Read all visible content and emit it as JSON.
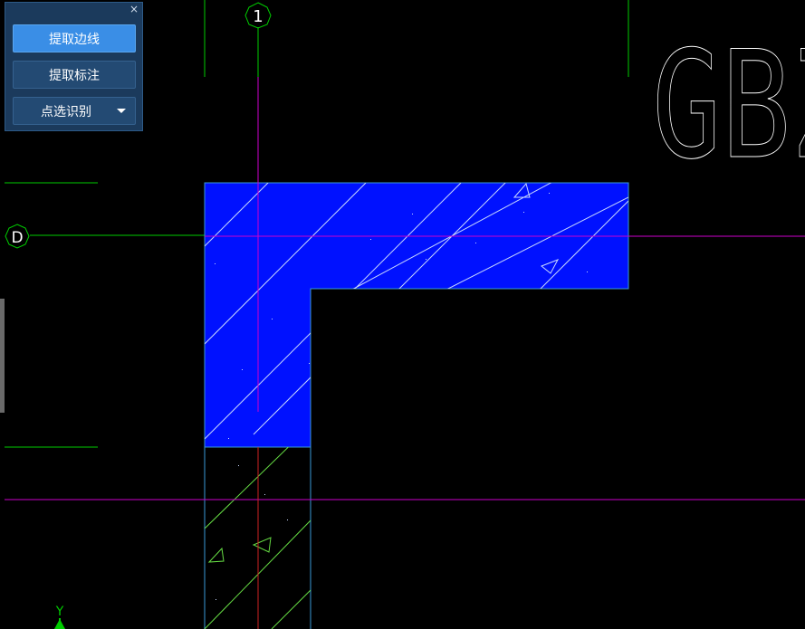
{
  "panel": {
    "close_glyph": "×",
    "buttons": [
      {
        "label": "提取边线",
        "active": true
      },
      {
        "label": "提取标注",
        "active": false
      },
      {
        "label": "点选识别",
        "active": false,
        "dropdown": true
      }
    ]
  },
  "canvas": {
    "axis_bubble_column": "1",
    "axis_bubble_row": "D",
    "label_text": "GBZ",
    "ucs_y_label": "Y"
  },
  "colors": {
    "background": "#000000",
    "wall_fill": "#0011ff",
    "wall_outline": "#3a9ad9",
    "axis_line": "#00cc00",
    "center_line": "#cc00cc",
    "red_line": "#cc2222",
    "hatch": "#ffffff",
    "hatch_lower": "#66dd44",
    "text": "#ffffff",
    "panel_bg": "#1b3a5c",
    "button_active": "#3a8ee6"
  }
}
